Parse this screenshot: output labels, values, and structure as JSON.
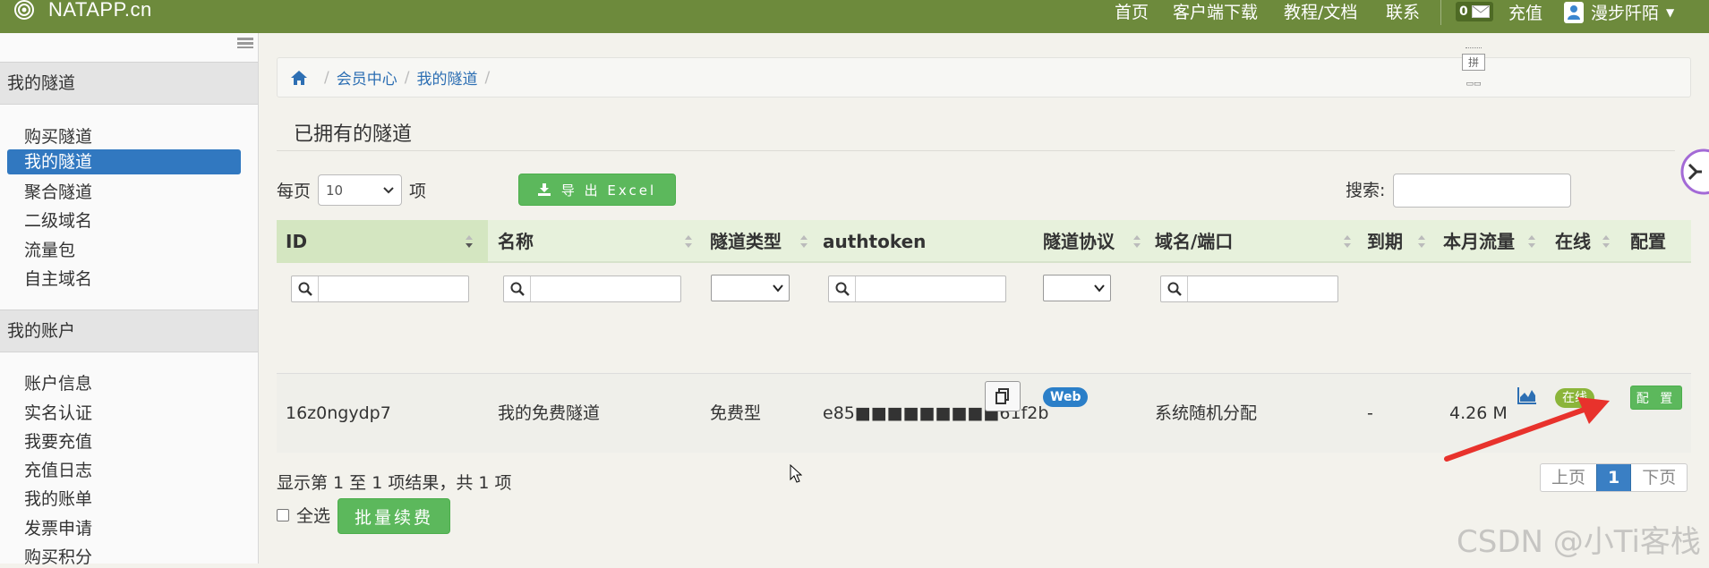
{
  "header": {
    "logo_text": "NATAPP.cn",
    "nav": [
      "首页",
      "客户端下载",
      "教程/文档",
      "联系"
    ],
    "mail_count": "0",
    "recharge": "充值",
    "username": "漫步阡陌"
  },
  "sidebar": {
    "section1": "我的隧道",
    "section1_items": [
      "购买隧道",
      "我的隧道",
      "聚合隧道",
      "二级域名",
      "流量包",
      "自主域名"
    ],
    "section2": "我的账户",
    "section2_items": [
      "账户信息",
      "实名认证",
      "我要充值",
      "充值日志",
      "我的账单",
      "发票申请",
      "购买积分"
    ]
  },
  "breadcrumb": [
    "会员中心",
    "我的隧道"
  ],
  "pinyin_tool": "拼",
  "page_title": "已拥有的隧道",
  "controls": {
    "per_page_prefix": "每页",
    "per_page_value": "10",
    "per_page_suffix": "项",
    "export_label": "导 出 Excel",
    "search_label": "搜索:"
  },
  "table": {
    "columns": [
      "ID",
      "名称",
      "隧道类型",
      "authtoken",
      "隧道协议",
      "域名/端口",
      "到期",
      "本月流量",
      "在线",
      "配置"
    ],
    "rows": [
      {
        "id": "16z0ngydp7",
        "name": "我的免费隧道",
        "type": "免费型",
        "authtoken": "e85■■■■■■■■■61f2b",
        "protocol": "Web",
        "domain": "系统随机分配",
        "expire": "-",
        "traffic": "4.26 M",
        "online": "在线",
        "config": "配 置"
      }
    ]
  },
  "footer": {
    "info": "显示第 1 至 1 项结果，共 1 项",
    "prev": "上页",
    "page": "1",
    "next": "下页",
    "select_all": "全选",
    "batch_renew": "批量续费"
  },
  "watermark": "CSDN @小Ti客栈",
  "colors": {
    "topbar": "#6d8a3c",
    "active": "#3178c0",
    "green_btn": "#5cb85c",
    "table_header": "#e7f1dc",
    "arrow": "#e8322c"
  }
}
